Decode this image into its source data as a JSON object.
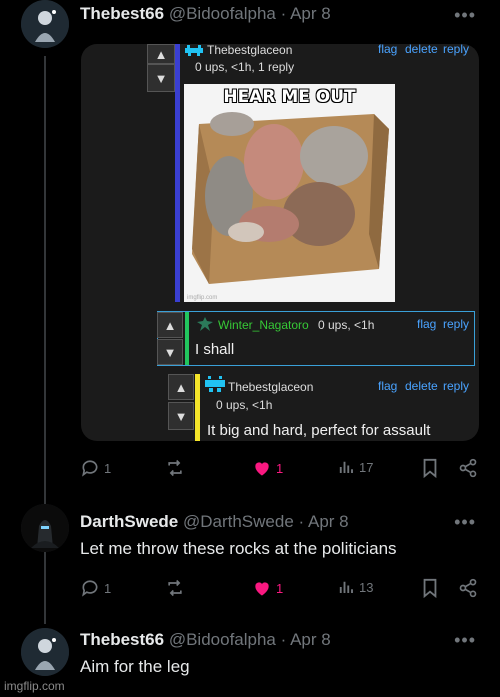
{
  "tweets": [
    {
      "name": "Thebest66",
      "handle": "@Bidoofalpha",
      "date": "Apr 8",
      "text": "",
      "replies": "1",
      "likes": "1",
      "views": "17"
    },
    {
      "name": "DarthSwede",
      "handle": "@DarthSwede",
      "date": "Apr 8",
      "text": "Let me throw these rocks at the politicians",
      "replies": "1",
      "likes": "1",
      "views": "13"
    },
    {
      "name": "Thebest66",
      "handle": "@Bidoofalpha",
      "date": "Apr 8",
      "text": "Aim for the leg"
    }
  ],
  "separator": "·",
  "more_glyph": "•••",
  "embed": {
    "comment1": {
      "user": "Thebestglaceon",
      "meta": "0 ups, <1h, 1 reply",
      "flag": "flag",
      "delete": "delete",
      "reply": "reply",
      "meme_caption": "HEAR ME OUT",
      "meme_watermark": "imgflip.com"
    },
    "comment2": {
      "user": "Winter_Nagatoro",
      "meta": "0 ups, <1h",
      "flag": "flag",
      "reply": "reply",
      "body": "I shall"
    },
    "comment3": {
      "user": "Thebestglaceon",
      "meta": "0 ups, <1h",
      "flag": "flag",
      "delete": "delete",
      "reply": "reply",
      "body": "It big and hard, perfect for assault"
    }
  },
  "watermark": "imgflip.com",
  "colors": {
    "like_pink": "#f91880",
    "link_blue": "#4aa3ff",
    "bar_blue": "#3a3fd1",
    "bar_green": "#22c55e",
    "bar_yellow": "#f5e52a",
    "username_green": "#36c936"
  }
}
